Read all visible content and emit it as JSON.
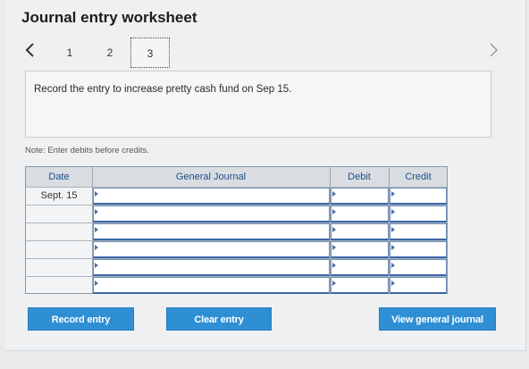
{
  "title": "Journal entry worksheet",
  "pager": {
    "pages": [
      "1",
      "2",
      "3"
    ],
    "current": "3"
  },
  "instruction": "Record the entry to increase pretty cash fund on Sep 15.",
  "note": "Note: Enter debits before credits.",
  "journal": {
    "headers": {
      "date": "Date",
      "general_journal": "General Journal",
      "debit": "Debit",
      "credit": "Credit"
    },
    "rows": [
      {
        "date": "Sept. 15",
        "account": "",
        "debit": "",
        "credit": ""
      },
      {
        "date": "",
        "account": "",
        "debit": "",
        "credit": ""
      },
      {
        "date": "",
        "account": "",
        "debit": "",
        "credit": ""
      },
      {
        "date": "",
        "account": "",
        "debit": "",
        "credit": ""
      },
      {
        "date": "",
        "account": "",
        "debit": "",
        "credit": ""
      },
      {
        "date": "",
        "account": "",
        "debit": "",
        "credit": ""
      }
    ]
  },
  "buttons": {
    "record": "Record entry",
    "clear": "Clear entry",
    "view": "View general journal"
  },
  "colors": {
    "button": "#2f8fd4",
    "header_text": "#1f4e8c"
  }
}
